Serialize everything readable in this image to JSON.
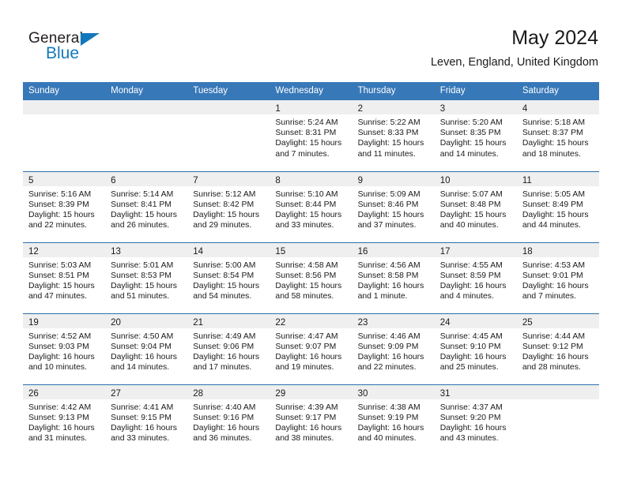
{
  "brand": {
    "name_top": "General",
    "name_bottom": "Blue",
    "accent_color": "#1278be",
    "triangle_icon": "triangle-icon"
  },
  "header": {
    "title": "May 2024",
    "location": "Leven, England, United Kingdom",
    "header_bg": "#3778b8",
    "day_band_bg": "#efefef"
  },
  "weekday_headers": [
    "Sunday",
    "Monday",
    "Tuesday",
    "Wednesday",
    "Thursday",
    "Friday",
    "Saturday"
  ],
  "labels": {
    "sunrise": "Sunrise:",
    "sunset": "Sunset:",
    "daylight": "Daylight:"
  },
  "weeks": [
    [
      {
        "day": "",
        "sunrise": "",
        "sunset": "",
        "daylight_line1": "",
        "daylight_line2": ""
      },
      {
        "day": "",
        "sunrise": "",
        "sunset": "",
        "daylight_line1": "",
        "daylight_line2": ""
      },
      {
        "day": "",
        "sunrise": "",
        "sunset": "",
        "daylight_line1": "",
        "daylight_line2": ""
      },
      {
        "day": "1",
        "sunrise": "Sunrise: 5:24 AM",
        "sunset": "Sunset: 8:31 PM",
        "daylight_line1": "Daylight: 15 hours",
        "daylight_line2": "and 7 minutes."
      },
      {
        "day": "2",
        "sunrise": "Sunrise: 5:22 AM",
        "sunset": "Sunset: 8:33 PM",
        "daylight_line1": "Daylight: 15 hours",
        "daylight_line2": "and 11 minutes."
      },
      {
        "day": "3",
        "sunrise": "Sunrise: 5:20 AM",
        "sunset": "Sunset: 8:35 PM",
        "daylight_line1": "Daylight: 15 hours",
        "daylight_line2": "and 14 minutes."
      },
      {
        "day": "4",
        "sunrise": "Sunrise: 5:18 AM",
        "sunset": "Sunset: 8:37 PM",
        "daylight_line1": "Daylight: 15 hours",
        "daylight_line2": "and 18 minutes."
      }
    ],
    [
      {
        "day": "5",
        "sunrise": "Sunrise: 5:16 AM",
        "sunset": "Sunset: 8:39 PM",
        "daylight_line1": "Daylight: 15 hours",
        "daylight_line2": "and 22 minutes."
      },
      {
        "day": "6",
        "sunrise": "Sunrise: 5:14 AM",
        "sunset": "Sunset: 8:41 PM",
        "daylight_line1": "Daylight: 15 hours",
        "daylight_line2": "and 26 minutes."
      },
      {
        "day": "7",
        "sunrise": "Sunrise: 5:12 AM",
        "sunset": "Sunset: 8:42 PM",
        "daylight_line1": "Daylight: 15 hours",
        "daylight_line2": "and 29 minutes."
      },
      {
        "day": "8",
        "sunrise": "Sunrise: 5:10 AM",
        "sunset": "Sunset: 8:44 PM",
        "daylight_line1": "Daylight: 15 hours",
        "daylight_line2": "and 33 minutes."
      },
      {
        "day": "9",
        "sunrise": "Sunrise: 5:09 AM",
        "sunset": "Sunset: 8:46 PM",
        "daylight_line1": "Daylight: 15 hours",
        "daylight_line2": "and 37 minutes."
      },
      {
        "day": "10",
        "sunrise": "Sunrise: 5:07 AM",
        "sunset": "Sunset: 8:48 PM",
        "daylight_line1": "Daylight: 15 hours",
        "daylight_line2": "and 40 minutes."
      },
      {
        "day": "11",
        "sunrise": "Sunrise: 5:05 AM",
        "sunset": "Sunset: 8:49 PM",
        "daylight_line1": "Daylight: 15 hours",
        "daylight_line2": "and 44 minutes."
      }
    ],
    [
      {
        "day": "12",
        "sunrise": "Sunrise: 5:03 AM",
        "sunset": "Sunset: 8:51 PM",
        "daylight_line1": "Daylight: 15 hours",
        "daylight_line2": "and 47 minutes."
      },
      {
        "day": "13",
        "sunrise": "Sunrise: 5:01 AM",
        "sunset": "Sunset: 8:53 PM",
        "daylight_line1": "Daylight: 15 hours",
        "daylight_line2": "and 51 minutes."
      },
      {
        "day": "14",
        "sunrise": "Sunrise: 5:00 AM",
        "sunset": "Sunset: 8:54 PM",
        "daylight_line1": "Daylight: 15 hours",
        "daylight_line2": "and 54 minutes."
      },
      {
        "day": "15",
        "sunrise": "Sunrise: 4:58 AM",
        "sunset": "Sunset: 8:56 PM",
        "daylight_line1": "Daylight: 15 hours",
        "daylight_line2": "and 58 minutes."
      },
      {
        "day": "16",
        "sunrise": "Sunrise: 4:56 AM",
        "sunset": "Sunset: 8:58 PM",
        "daylight_line1": "Daylight: 16 hours",
        "daylight_line2": "and 1 minute."
      },
      {
        "day": "17",
        "sunrise": "Sunrise: 4:55 AM",
        "sunset": "Sunset: 8:59 PM",
        "daylight_line1": "Daylight: 16 hours",
        "daylight_line2": "and 4 minutes."
      },
      {
        "day": "18",
        "sunrise": "Sunrise: 4:53 AM",
        "sunset": "Sunset: 9:01 PM",
        "daylight_line1": "Daylight: 16 hours",
        "daylight_line2": "and 7 minutes."
      }
    ],
    [
      {
        "day": "19",
        "sunrise": "Sunrise: 4:52 AM",
        "sunset": "Sunset: 9:03 PM",
        "daylight_line1": "Daylight: 16 hours",
        "daylight_line2": "and 10 minutes."
      },
      {
        "day": "20",
        "sunrise": "Sunrise: 4:50 AM",
        "sunset": "Sunset: 9:04 PM",
        "daylight_line1": "Daylight: 16 hours",
        "daylight_line2": "and 14 minutes."
      },
      {
        "day": "21",
        "sunrise": "Sunrise: 4:49 AM",
        "sunset": "Sunset: 9:06 PM",
        "daylight_line1": "Daylight: 16 hours",
        "daylight_line2": "and 17 minutes."
      },
      {
        "day": "22",
        "sunrise": "Sunrise: 4:47 AM",
        "sunset": "Sunset: 9:07 PM",
        "daylight_line1": "Daylight: 16 hours",
        "daylight_line2": "and 19 minutes."
      },
      {
        "day": "23",
        "sunrise": "Sunrise: 4:46 AM",
        "sunset": "Sunset: 9:09 PM",
        "daylight_line1": "Daylight: 16 hours",
        "daylight_line2": "and 22 minutes."
      },
      {
        "day": "24",
        "sunrise": "Sunrise: 4:45 AM",
        "sunset": "Sunset: 9:10 PM",
        "daylight_line1": "Daylight: 16 hours",
        "daylight_line2": "and 25 minutes."
      },
      {
        "day": "25",
        "sunrise": "Sunrise: 4:44 AM",
        "sunset": "Sunset: 9:12 PM",
        "daylight_line1": "Daylight: 16 hours",
        "daylight_line2": "and 28 minutes."
      }
    ],
    [
      {
        "day": "26",
        "sunrise": "Sunrise: 4:42 AM",
        "sunset": "Sunset: 9:13 PM",
        "daylight_line1": "Daylight: 16 hours",
        "daylight_line2": "and 31 minutes."
      },
      {
        "day": "27",
        "sunrise": "Sunrise: 4:41 AM",
        "sunset": "Sunset: 9:15 PM",
        "daylight_line1": "Daylight: 16 hours",
        "daylight_line2": "and 33 minutes."
      },
      {
        "day": "28",
        "sunrise": "Sunrise: 4:40 AM",
        "sunset": "Sunset: 9:16 PM",
        "daylight_line1": "Daylight: 16 hours",
        "daylight_line2": "and 36 minutes."
      },
      {
        "day": "29",
        "sunrise": "Sunrise: 4:39 AM",
        "sunset": "Sunset: 9:17 PM",
        "daylight_line1": "Daylight: 16 hours",
        "daylight_line2": "and 38 minutes."
      },
      {
        "day": "30",
        "sunrise": "Sunrise: 4:38 AM",
        "sunset": "Sunset: 9:19 PM",
        "daylight_line1": "Daylight: 16 hours",
        "daylight_line2": "and 40 minutes."
      },
      {
        "day": "31",
        "sunrise": "Sunrise: 4:37 AM",
        "sunset": "Sunset: 9:20 PM",
        "daylight_line1": "Daylight: 16 hours",
        "daylight_line2": "and 43 minutes."
      },
      {
        "day": "",
        "sunrise": "",
        "sunset": "",
        "daylight_line1": "",
        "daylight_line2": ""
      }
    ]
  ]
}
